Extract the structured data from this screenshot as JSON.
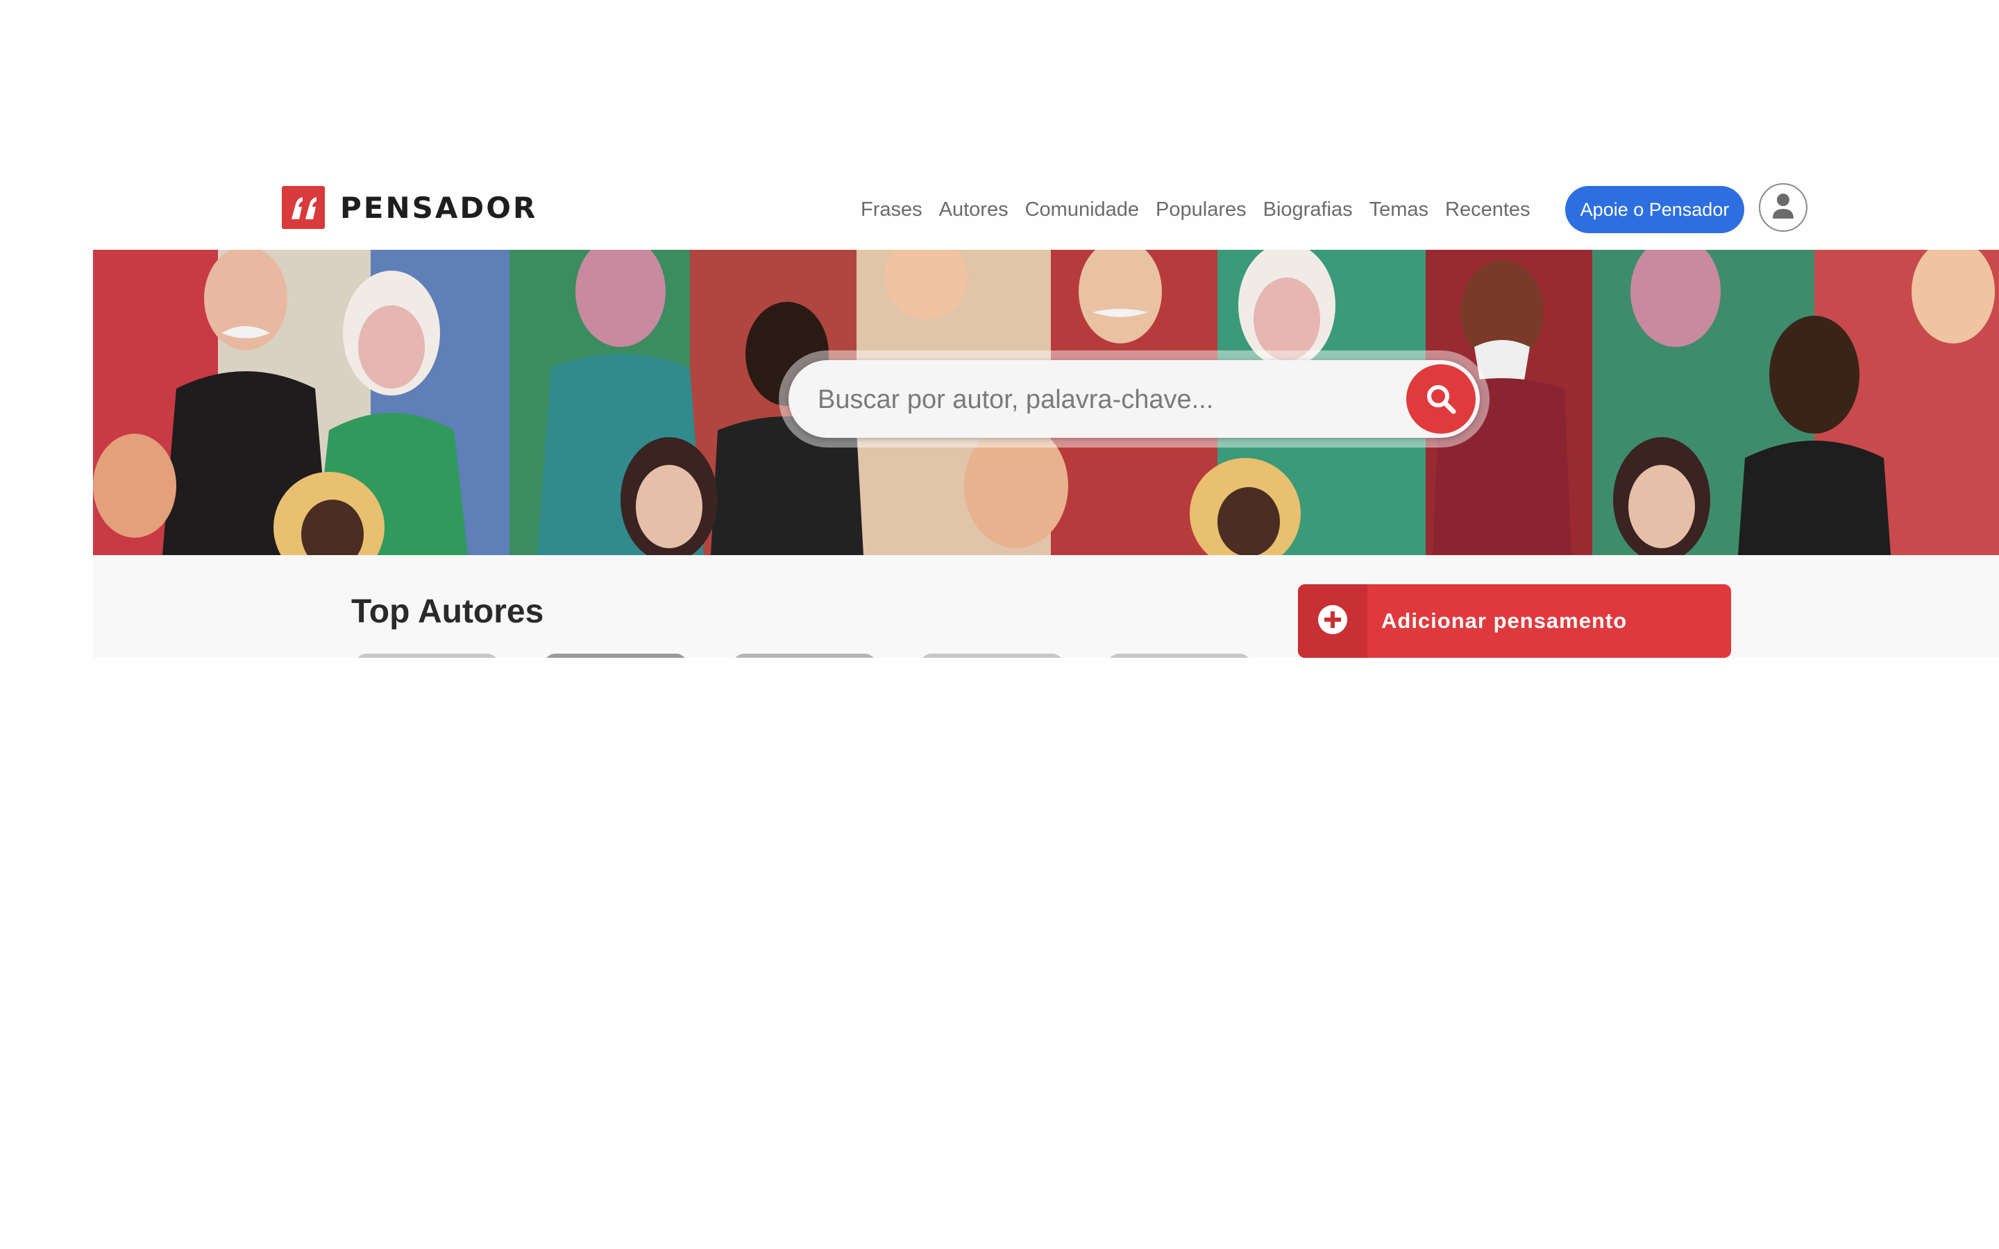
{
  "brand": {
    "name": "PENSADOR",
    "color": "#d93a3c"
  },
  "nav": {
    "items": [
      "Frases",
      "Autores",
      "Comunidade",
      "Populares",
      "Biografias",
      "Temas",
      "Recentes"
    ],
    "support_label": "Apoie o Pensador",
    "support_color": "#2d6fe0",
    "user_icon": "user-icon"
  },
  "search": {
    "placeholder": "Buscar por autor, palavra-chave...",
    "value": "",
    "button_icon": "search-icon",
    "button_color": "#e03a3c"
  },
  "main": {
    "section_title": "Top Autores",
    "add_label": "Adicionar pensamento",
    "add_icon": "plus-circle-icon",
    "add_color": "#e0393d"
  }
}
